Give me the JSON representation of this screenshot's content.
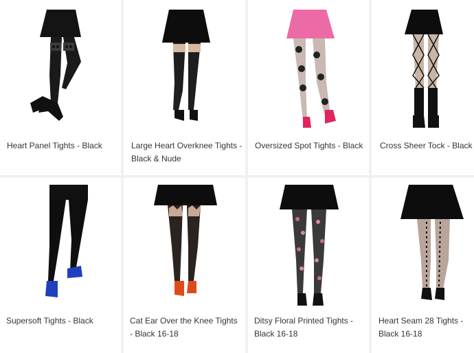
{
  "products": [
    {
      "name": "Heart Panel Tights - Black",
      "shoe_color": "#111111",
      "legwear": "heart-panel-over-knee",
      "skirt": "black-skater"
    },
    {
      "name": "Large Heart Overknee Tights - Black & Nude",
      "shoe_color": "#111111",
      "legwear": "large-heart-over-knee",
      "skirt": "black-leather-skater"
    },
    {
      "name": "Oversized Spot Tights - Black",
      "shoe_color": "#e0245e",
      "legwear": "oversized-spot-sheer",
      "skirt": "pink-skater"
    },
    {
      "name": "Cross Sheer Tock - Black",
      "shoe_color": "#111111",
      "legwear": "diamond-mesh-sock",
      "skirt": "black-leather-skater"
    },
    {
      "name": "Supersoft Tights - Black",
      "shoe_color": "#1f3fbf",
      "legwear": "opaque-black",
      "skirt": "black-mini"
    },
    {
      "name": "Cat Ear Over the Knee Tights - Black 16-18",
      "shoe_color": "#e04a1a",
      "legwear": "cat-ear-over-knee",
      "skirt": "black-leather-skater"
    },
    {
      "name": "Ditsy Floral Printed Tights - Black 16-18",
      "shoe_color": "#111111",
      "legwear": "floral-print",
      "skirt": "black-skater"
    },
    {
      "name": "Heart Seam 28 Tights - Black 16-18",
      "shoe_color": "#111111",
      "legwear": "heart-seam-sheer",
      "skirt": "black-skater"
    }
  ]
}
